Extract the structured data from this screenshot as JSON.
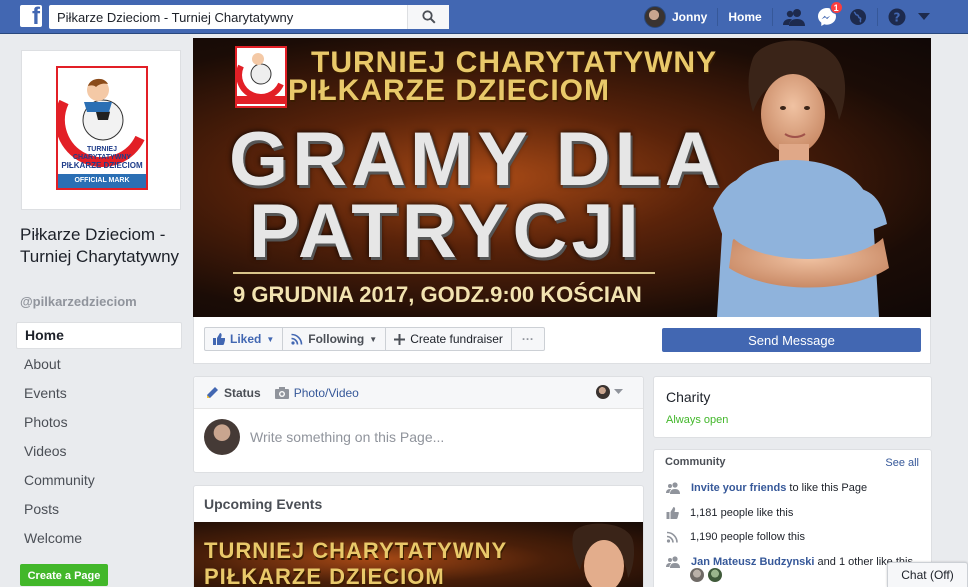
{
  "topbar": {
    "search_value": "Piłkarze Dzieciom - Turniej Charytatywny",
    "user_name": "Jonny",
    "home_label": "Home",
    "messages_badge": "1"
  },
  "page": {
    "name": "Piłkarze Dzieciom - Turniej Charytatywny",
    "handle": "@pilkarzedzieciom",
    "create_page_label": "Create a Page"
  },
  "logo": {
    "line1": "TURNIEJ CHARYTATYWNY",
    "line2": "PIŁKARZE DZIECIOM",
    "mark": "OFFICIAL MARK"
  },
  "leftnav": {
    "items": [
      "Home",
      "About",
      "Events",
      "Photos",
      "Videos",
      "Community",
      "Posts",
      "Welcome"
    ]
  },
  "cover": {
    "line1": "TURNIEJ CHARYTATYWNY",
    "line2": "PIŁKARZE DZIECIOM",
    "big1": "GRAMY DLA",
    "big2": "PATRYCJI",
    "date_line": "9 GRUDNIA 2017, GODZ.9:00 KOŚCIAN"
  },
  "actions": {
    "liked_label": "Liked",
    "following_label": "Following",
    "fundraiser_label": "Create fundraiser",
    "more_label": "···",
    "send_message_label": "Send Message"
  },
  "composer": {
    "tab_status": "Status",
    "tab_photo": "Photo/Video",
    "placeholder": "Write something on this Page..."
  },
  "events": {
    "title": "Upcoming Events",
    "img_line1": "TURNIEJ CHARYTATYWNY",
    "img_line2": "PIŁKARZE DZIECIOM"
  },
  "charity": {
    "title": "Charity",
    "status": "Always open"
  },
  "community": {
    "heading": "Community",
    "see_all": "See all",
    "invite_link": "Invite your friends",
    "invite_rest": "to like this Page",
    "likes": "1,181 people like this",
    "follows": "1,190 people follow this",
    "friend_name": "Jan Mateusz Budzynski",
    "friend_rest": "and 1 other like this"
  },
  "chat": {
    "label": "Chat (Off)"
  },
  "colors": {
    "fb_blue": "#4267b2",
    "green": "#42b72a",
    "link": "#365899",
    "badge_red": "#fa3e3e"
  }
}
